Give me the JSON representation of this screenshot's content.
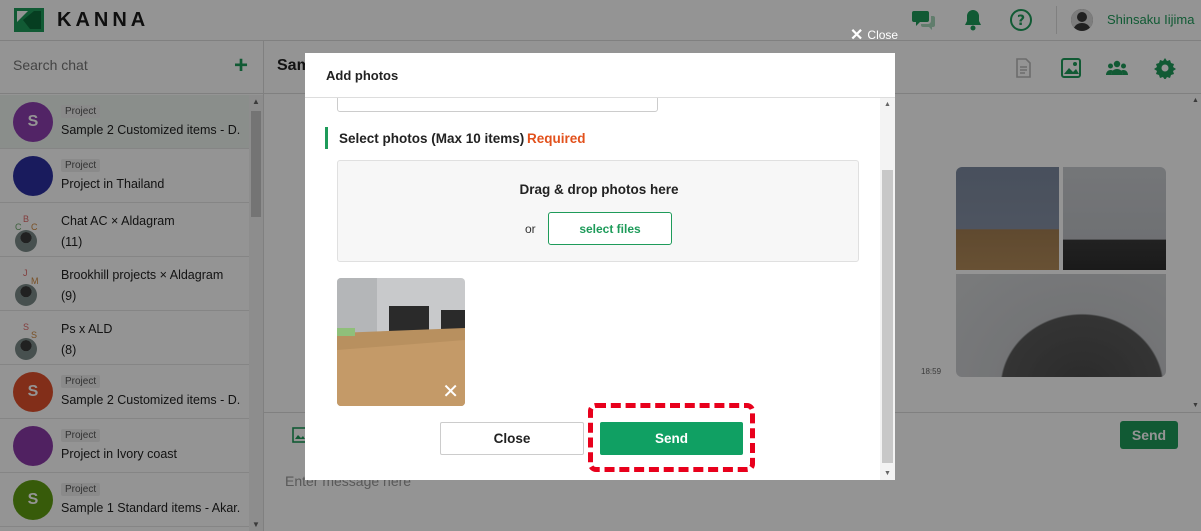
{
  "app": {
    "brand": "KANNA",
    "user_name": "Shinsaku Iijima"
  },
  "sidebar": {
    "search_placeholder": "Search chat",
    "add_label": "+",
    "items": [
      {
        "avatar": "S",
        "color": "#8e3fb0",
        "tag": "Project",
        "name": "Sample 2 Customized items - D...",
        "count": "",
        "active": true
      },
      {
        "avatar": "",
        "color": "#2b2fa0",
        "tag": "Project",
        "name": "Project in Thailand",
        "count": "",
        "active": false
      },
      {
        "avatar": "multi",
        "color": "",
        "tag": "",
        "name": "Chat AC × Aldagram",
        "count": "(11)",
        "letters": [
          "B",
          "C",
          "C",
          "B"
        ],
        "active": false
      },
      {
        "avatar": "multi",
        "color": "",
        "tag": "",
        "name": "Brookhill projects × Aldagram",
        "count": "(9)",
        "letters": [
          "J",
          "M"
        ],
        "active": false
      },
      {
        "avatar": "multi",
        "color": "",
        "tag": "",
        "name": "Ps x ALD",
        "count": "(8)",
        "letters": [
          "S",
          "S"
        ],
        "active": false
      },
      {
        "avatar": "S",
        "color": "#e0502c",
        "tag": "Project",
        "name": "Sample 2 Customized items - D...",
        "count": "",
        "active": false
      },
      {
        "avatar": "",
        "color": "#8a3aa8",
        "tag": "Project",
        "name": "Project in Ivory coast",
        "count": "",
        "active": false
      },
      {
        "avatar": "S",
        "color": "#5f9e12",
        "tag": "Project",
        "name": "Sample 1 Standard items - Akar...",
        "count": "",
        "active": false
      }
    ]
  },
  "main": {
    "title": "Sam",
    "message_time": "18:59",
    "send_label": "Send",
    "composer_placeholder": "Enter message here"
  },
  "overlay": {
    "close_label": "Close"
  },
  "modal": {
    "title": "Add photos",
    "section_label": "Select photos (Max 10 items)",
    "required_label": "Required",
    "dropzone_title": "Drag & drop photos here",
    "or_label": "or",
    "select_files_label": "select files",
    "remove_label": "✕",
    "close_button": "Close",
    "send_button": "Send"
  },
  "colors": {
    "accent": "#1e9b5a",
    "required": "#e2511c",
    "highlight": "#e8001c"
  }
}
